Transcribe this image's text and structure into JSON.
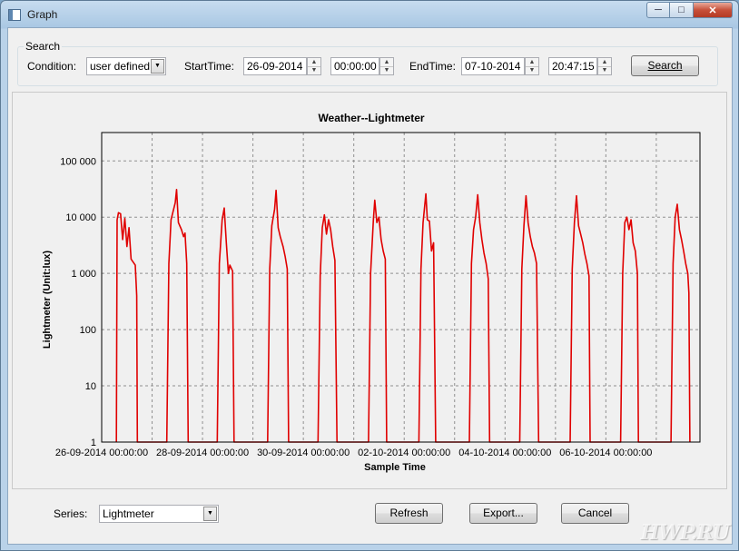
{
  "window": {
    "title": "Graph"
  },
  "search": {
    "legend": "Search",
    "condition_label": "Condition:",
    "condition_value": "user defined",
    "start_label": "StartTime:",
    "start_date": "26-09-2014",
    "start_time": "00:00:00",
    "end_label": "EndTime:",
    "end_date": "07-10-2014",
    "end_time": "20:47:15",
    "search_button": "Search"
  },
  "footer": {
    "series_label": "Series:",
    "series_value": "Lightmeter",
    "refresh_button": "Refresh",
    "export_button": "Export...",
    "cancel_button": "Cancel"
  },
  "watermark": "HWP.RU",
  "colors": {
    "series": "#e00000",
    "grid": "#909090"
  },
  "chart_data": {
    "type": "line",
    "title": "Weather--Lightmeter",
    "xlabel": "Sample Time",
    "ylabel": "Lightmeter (Unit:lux)",
    "y_scale": "log",
    "ylim": [
      1,
      320000
    ],
    "y_ticks": [
      {
        "v": 1,
        "label": "1"
      },
      {
        "v": 10,
        "label": "10"
      },
      {
        "v": 100,
        "label": "100"
      },
      {
        "v": 1000,
        "label": "1 000"
      },
      {
        "v": 10000,
        "label": "10 000"
      },
      {
        "v": 100000,
        "label": "100 000"
      }
    ],
    "xlim": [
      "2014-09-26 00:00:00",
      "2014-10-07 20:47:15"
    ],
    "x_ticks": [
      {
        "t": "2014-09-26 00:00:00",
        "label": "26-09-2014 00:00:00"
      },
      {
        "t": "2014-09-27 00:00:00",
        "label": ""
      },
      {
        "t": "2014-09-28 00:00:00",
        "label": "28-09-2014 00:00:00"
      },
      {
        "t": "2014-09-29 00:00:00",
        "label": ""
      },
      {
        "t": "2014-09-30 00:00:00",
        "label": "30-09-2014 00:00:00"
      },
      {
        "t": "2014-10-01 00:00:00",
        "label": ""
      },
      {
        "t": "2014-10-02 00:00:00",
        "label": "02-10-2014 00:00:00"
      },
      {
        "t": "2014-10-03 00:00:00",
        "label": ""
      },
      {
        "t": "2014-10-04 00:00:00",
        "label": "04-10-2014 00:00:00"
      },
      {
        "t": "2014-10-05 00:00:00",
        "label": ""
      },
      {
        "t": "2014-10-06 00:00:00",
        "label": "06-10-2014 00:00:00"
      },
      {
        "t": "2014-10-07 00:00:00",
        "label": ""
      }
    ],
    "grid": true,
    "legend": "none",
    "series": [
      {
        "color": "#e00000",
        "points": [
          [
            "2014-09-26 07:00",
            1
          ],
          [
            "2014-09-26 07:20",
            9000
          ],
          [
            "2014-09-26 08:00",
            12000
          ],
          [
            "2014-09-26 09:00",
            11500
          ],
          [
            "2014-09-26 10:00",
            4000
          ],
          [
            "2014-09-26 11:00",
            9500
          ],
          [
            "2014-09-26 12:00",
            3000
          ],
          [
            "2014-09-26 13:00",
            6500
          ],
          [
            "2014-09-26 14:00",
            1800
          ],
          [
            "2014-09-26 16:00",
            1400
          ],
          [
            "2014-09-26 16:40",
            400
          ],
          [
            "2014-09-26 17:00",
            1
          ],
          [
            "2014-09-27 07:00",
            1
          ],
          [
            "2014-09-27 08:00",
            1500
          ],
          [
            "2014-09-27 09:00",
            9000
          ],
          [
            "2014-09-27 11:00",
            18000
          ],
          [
            "2014-09-27 11:40",
            31000
          ],
          [
            "2014-09-27 12:30",
            8000
          ],
          [
            "2014-09-27 14:00",
            6000
          ],
          [
            "2014-09-27 15:00",
            4500
          ],
          [
            "2014-09-27 15:40",
            5200
          ],
          [
            "2014-09-27 16:30",
            1500
          ],
          [
            "2014-09-27 17:10",
            1
          ],
          [
            "2014-09-28 07:00",
            1
          ],
          [
            "2014-09-28 08:00",
            1500
          ],
          [
            "2014-09-28 09:20",
            9000
          ],
          [
            "2014-09-28 10:20",
            14500
          ],
          [
            "2014-09-28 11:20",
            3500
          ],
          [
            "2014-09-28 12:20",
            1000
          ],
          [
            "2014-09-28 13:00",
            1400
          ],
          [
            "2014-09-28 14:20",
            1100
          ],
          [
            "2014-09-28 15:00",
            1
          ],
          [
            "2014-09-29 07:00",
            1
          ],
          [
            "2014-09-29 08:00",
            1200
          ],
          [
            "2014-09-29 09:00",
            7000
          ],
          [
            "2014-09-29 10:20",
            14000
          ],
          [
            "2014-09-29 11:00",
            30000
          ],
          [
            "2014-09-29 12:00",
            6500
          ],
          [
            "2014-09-29 13:00",
            4500
          ],
          [
            "2014-09-29 14:20",
            3000
          ],
          [
            "2014-09-29 15:20",
            2000
          ],
          [
            "2014-09-29 16:20",
            1200
          ],
          [
            "2014-09-29 17:00",
            1
          ],
          [
            "2014-09-30 07:00",
            1
          ],
          [
            "2014-09-30 08:00",
            900
          ],
          [
            "2014-09-30 09:00",
            6500
          ],
          [
            "2014-09-30 10:00",
            11000
          ],
          [
            "2014-09-30 11:00",
            5000
          ],
          [
            "2014-09-30 12:00",
            9000
          ],
          [
            "2014-09-30 13:00",
            6000
          ],
          [
            "2014-09-30 14:00",
            3000
          ],
          [
            "2014-09-30 15:00",
            1700
          ],
          [
            "2014-09-30 16:00",
            1
          ],
          [
            "2014-10-01 07:00",
            1
          ],
          [
            "2014-10-01 08:00",
            1000
          ],
          [
            "2014-10-01 09:20",
            9000
          ],
          [
            "2014-10-01 10:00",
            20000
          ],
          [
            "2014-10-01 11:00",
            8000
          ],
          [
            "2014-10-01 12:00",
            10000
          ],
          [
            "2014-10-01 13:00",
            4000
          ],
          [
            "2014-10-01 14:00",
            2500
          ],
          [
            "2014-10-01 15:00",
            1800
          ],
          [
            "2014-10-01 15:40",
            1
          ],
          [
            "2014-10-02 07:00",
            1
          ],
          [
            "2014-10-02 08:00",
            1200
          ],
          [
            "2014-10-02 09:00",
            8000
          ],
          [
            "2014-10-02 10:20",
            26000
          ],
          [
            "2014-10-02 11:00",
            9000
          ],
          [
            "2014-10-02 12:00",
            8500
          ],
          [
            "2014-10-02 13:00",
            2500
          ],
          [
            "2014-10-02 14:00",
            3500
          ],
          [
            "2014-10-02 15:00",
            1
          ],
          [
            "2014-10-03 07:00",
            1
          ],
          [
            "2014-10-03 08:00",
            1500
          ],
          [
            "2014-10-03 09:00",
            6000
          ],
          [
            "2014-10-03 10:00",
            10000
          ],
          [
            "2014-10-03 11:00",
            25000
          ],
          [
            "2014-10-03 12:00",
            8000
          ],
          [
            "2014-10-03 13:00",
            4000
          ],
          [
            "2014-10-03 14:00",
            2300
          ],
          [
            "2014-10-03 15:00",
            1500
          ],
          [
            "2014-10-03 16:00",
            800
          ],
          [
            "2014-10-03 16:40",
            1
          ],
          [
            "2014-10-04 07:00",
            1
          ],
          [
            "2014-10-04 08:00",
            1200
          ],
          [
            "2014-10-04 09:00",
            7000
          ],
          [
            "2014-10-04 10:00",
            24000
          ],
          [
            "2014-10-04 11:00",
            8000
          ],
          [
            "2014-10-04 12:00",
            4500
          ],
          [
            "2014-10-04 13:00",
            3000
          ],
          [
            "2014-10-04 14:00",
            2300
          ],
          [
            "2014-10-04 15:00",
            1500
          ],
          [
            "2014-10-04 16:00",
            1
          ],
          [
            "2014-10-05 07:00",
            1
          ],
          [
            "2014-10-05 08:00",
            1200
          ],
          [
            "2014-10-05 09:00",
            8000
          ],
          [
            "2014-10-05 10:00",
            24000
          ],
          [
            "2014-10-05 11:00",
            7000
          ],
          [
            "2014-10-05 12:00",
            5000
          ],
          [
            "2014-10-05 13:00",
            3500
          ],
          [
            "2014-10-05 14:00",
            2200
          ],
          [
            "2014-10-05 15:00",
            1500
          ],
          [
            "2014-10-05 16:00",
            900
          ],
          [
            "2014-10-05 16:30",
            1
          ],
          [
            "2014-10-06 07:00",
            1
          ],
          [
            "2014-10-06 08:00",
            1000
          ],
          [
            "2014-10-06 09:00",
            8000
          ],
          [
            "2014-10-06 10:00",
            10000
          ],
          [
            "2014-10-06 11:00",
            6000
          ],
          [
            "2014-10-06 12:00",
            9000
          ],
          [
            "2014-10-06 13:00",
            3500
          ],
          [
            "2014-10-06 14:00",
            2500
          ],
          [
            "2014-10-06 15:00",
            1000
          ],
          [
            "2014-10-06 15:30",
            1
          ],
          [
            "2014-10-07 07:00",
            1
          ],
          [
            "2014-10-07 08:00",
            1500
          ],
          [
            "2014-10-07 09:00",
            10000
          ],
          [
            "2014-10-07 10:00",
            17000
          ],
          [
            "2014-10-07 11:00",
            6000
          ],
          [
            "2014-10-07 12:00",
            4000
          ],
          [
            "2014-10-07 13:00",
            2500
          ],
          [
            "2014-10-07 14:00",
            1500
          ],
          [
            "2014-10-07 15:00",
            1000
          ],
          [
            "2014-10-07 15:30",
            450
          ],
          [
            "2014-10-07 16:00",
            1
          ]
        ]
      }
    ]
  }
}
